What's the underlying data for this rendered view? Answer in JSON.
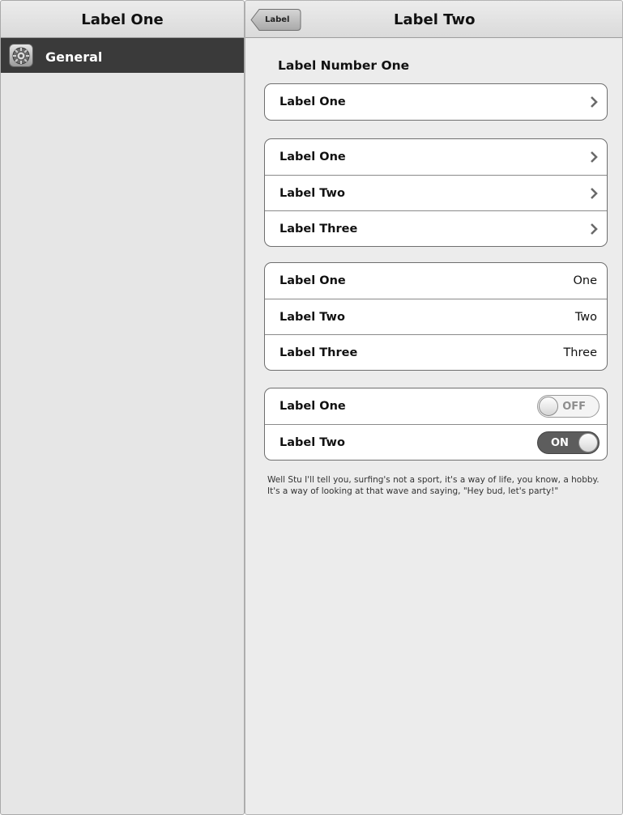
{
  "master": {
    "title": "Label One",
    "items": [
      {
        "label": "General",
        "icon": "gear-icon"
      }
    ]
  },
  "detail": {
    "title": "Label Two",
    "back_label": "Label",
    "section_header": "Label Number One",
    "group1": [
      {
        "label": "Label One"
      }
    ],
    "group2": [
      {
        "label": "Label One"
      },
      {
        "label": "Label Two"
      },
      {
        "label": "Label Three"
      }
    ],
    "group3": [
      {
        "label": "Label One",
        "value": "One"
      },
      {
        "label": "Label Two",
        "value": "Two"
      },
      {
        "label": "Label Three",
        "value": "Three"
      }
    ],
    "group4": [
      {
        "label": "Label One",
        "state": "OFF"
      },
      {
        "label": "Label Two",
        "state": "ON"
      }
    ],
    "footer": "Well Stu I'll tell you, surfing's not a sport, it's a way of life, you know, a hobby. It's a way of looking at that wave and saying, \"Hey bud, let's party!\""
  },
  "colors": {
    "selected_row": "#3a3a3a",
    "detail_background": "#ececec",
    "master_background": "#e6e6e6",
    "toggle_on": "#5d5d5d"
  }
}
